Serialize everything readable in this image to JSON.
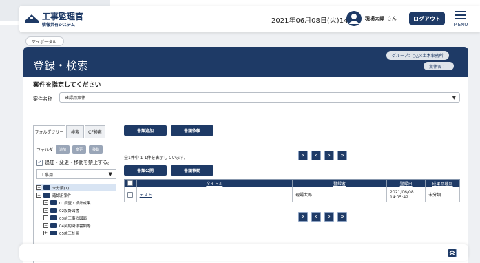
{
  "header": {
    "app_title": "工事監理官",
    "app_subtitle": "情報共有システム",
    "datetime": "2021年06月08日(火)14:07",
    "user_name": "現場太郎",
    "user_honorific": "さん",
    "logout_label": "ログアウト",
    "menu_label": "MENU"
  },
  "breadcrumb": {
    "item": "マイポータル"
  },
  "page": {
    "title": "登録・検索",
    "group_badge": "グループ：○△×土木事務所",
    "case_badge": "案件名 ：-",
    "specify_label": "案件を指定してください",
    "case_name_label": "案件名称",
    "case_select_value": "確認用案件"
  },
  "left_panel": {
    "tabs": [
      {
        "label": "フォルダツリー"
      },
      {
        "label": "検索"
      },
      {
        "label": "CF検索"
      }
    ],
    "folder_label": "フォルダ",
    "folder_buttons": [
      "追加",
      "変更",
      "移動"
    ],
    "lock_label": "追加・変更・移動を禁止する。",
    "lock_checked": true,
    "kind_select_value": "工事用",
    "tree": [
      {
        "toggle": "−",
        "label": "未分類(1)",
        "level": 0,
        "selected": true
      },
      {
        "toggle": "−",
        "label": "確認用案件",
        "level": 0
      },
      {
        "toggle": "−",
        "label": "01調査・設計成果",
        "level": 1
      },
      {
        "toggle": "−",
        "label": "02設計図書",
        "level": 1
      },
      {
        "toggle": "−",
        "label": "03前工事の図面",
        "level": 1
      },
      {
        "toggle": "−",
        "label": "04契約関係書類等",
        "level": 1
      },
      {
        "toggle": "+",
        "label": "05施工計画",
        "level": 1
      }
    ]
  },
  "toolbar": {
    "add_doc": "書類追加",
    "request_doc": "書類依頼",
    "publish_doc": "書類公開",
    "move_doc": "書類移動"
  },
  "result_summary": "全1件中 1-1件を表示しています。",
  "pager": {
    "first": "«",
    "prev": "‹",
    "next": "›",
    "last": "»"
  },
  "table": {
    "columns": [
      "タイトル",
      "登録者",
      "登録日",
      "成果品種別"
    ],
    "rows": [
      {
        "title": "テスト",
        "registrant": "現場太郎",
        "date": "2021/06/08",
        "time": "14:05:42",
        "category": "未分類"
      }
    ]
  },
  "footer": {
    "top_icon": "chevron-up-icon"
  },
  "colors": {
    "primary": "#1e3a66",
    "background": "#eef0f3"
  }
}
